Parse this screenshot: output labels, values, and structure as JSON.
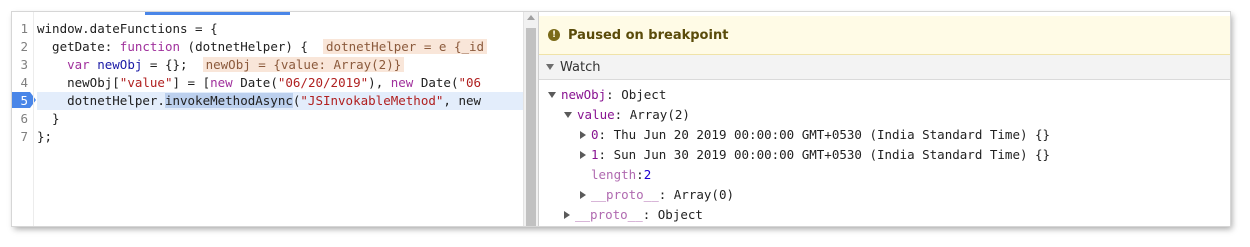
{
  "editor": {
    "line_numbers": [
      "1",
      "2",
      "3",
      "4",
      "5",
      "6",
      "7"
    ],
    "current_line": "5",
    "lines": {
      "l1": "window.dateFunctions = {",
      "l2_prefix": "  getDate: ",
      "l2_kw": "function",
      "l2_args": " (dotnetHelper) {  ",
      "l2_inline": "dotnetHelper = e {_id",
      "l3_indent": "    ",
      "l3_kw": "var",
      "l3_var": " newObj",
      "l3_rest": " = {};  ",
      "l3_inline": "newObj = {value: Array(2)}",
      "l4_indent": "    ",
      "l4_a": "newObj[",
      "l4_str1": "\"value\"",
      "l4_b": "] = [",
      "l4_kw1": "new",
      "l4_c": " Date(",
      "l4_str2": "\"06/20/2019\"",
      "l4_d": "), ",
      "l4_kw2": "new",
      "l4_e": " Date(",
      "l4_str3": "\"06",
      "l5_indent": "    dotnetHelper.",
      "l5_sel": "invokeMethodAsync",
      "l5_a": "(",
      "l5_str": "\"JSInvokableMethod\"",
      "l5_b": ", new",
      "l6": "  }",
      "l7": "};"
    }
  },
  "debugger": {
    "paused_icon": "info-icon",
    "paused_text": "Paused on breakpoint",
    "watch_label": "Watch",
    "tree": {
      "root_name": "newObj",
      "root_value": ": Object",
      "value_name": "value",
      "value_value": ": Array(2)",
      "item0_name": "0",
      "item0_value": ": Thu Jun 20 2019 00:00:00 GMT+0530 (India Standard Time) {}",
      "item1_name": "1",
      "item1_value": ": Sun Jun 30 2019 00:00:00 GMT+0530 (India Standard Time) {}",
      "length_name": "length",
      "length_sep": ": ",
      "length_value": "2",
      "proto_arr_name": "__proto__",
      "proto_arr_value": ": Array(0)",
      "proto_obj_name": "__proto__",
      "proto_obj_value": ": Object"
    }
  },
  "colors": {
    "breakpoint_marker": "#4a86e8",
    "paused_banner": "#fffbe6",
    "property_name": "#881391",
    "number": "#1c00cf"
  }
}
